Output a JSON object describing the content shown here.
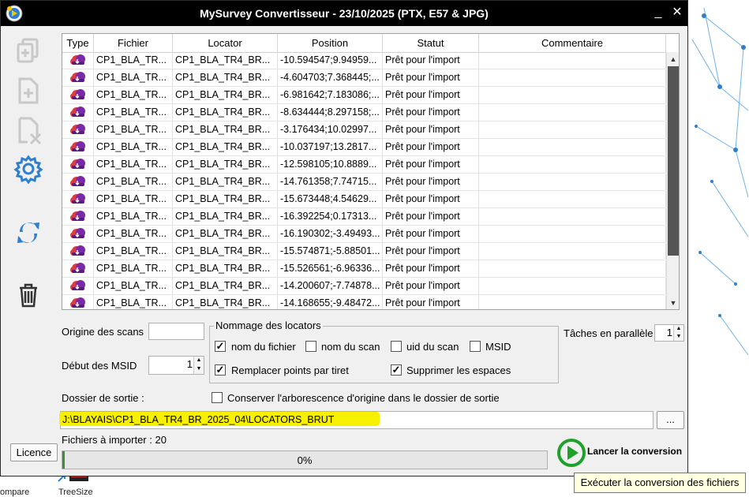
{
  "window": {
    "title": "MySurvey Convertisseur - 23/10/2025 (PTX, E57 & JPG)",
    "minimize_glyph": "_",
    "close_glyph": "✕"
  },
  "sidebar": {
    "icons": [
      "add-scan-icon",
      "add-file-icon",
      "remove-file-icon",
      "settings-gear-icon",
      "refresh-icon",
      "trash-icon"
    ]
  },
  "table": {
    "columns": [
      "Type",
      "Fichier",
      "Locator",
      "Position",
      "Statut",
      "Commentaire"
    ],
    "rows": [
      {
        "fichier": "CP1_BLA_TR...",
        "locator": "CP1_BLA_TR4_BR...",
        "position": "-10.594547;9.94959...",
        "statut": "Prêt pour l'import",
        "commentaire": ""
      },
      {
        "fichier": "CP1_BLA_TR...",
        "locator": "CP1_BLA_TR4_BR...",
        "position": "-4.604703;7.368445;...",
        "statut": "Prêt pour l'import",
        "commentaire": ""
      },
      {
        "fichier": "CP1_BLA_TR...",
        "locator": "CP1_BLA_TR4_BR...",
        "position": "-6.981642;7.183086;...",
        "statut": "Prêt pour l'import",
        "commentaire": ""
      },
      {
        "fichier": "CP1_BLA_TR...",
        "locator": "CP1_BLA_TR4_BR...",
        "position": "-8.634444;8.297158;...",
        "statut": "Prêt pour l'import",
        "commentaire": ""
      },
      {
        "fichier": "CP1_BLA_TR...",
        "locator": "CP1_BLA_TR4_BR...",
        "position": "-3.176434;10.02997...",
        "statut": "Prêt pour l'import",
        "commentaire": ""
      },
      {
        "fichier": "CP1_BLA_TR...",
        "locator": "CP1_BLA_TR4_BR...",
        "position": "-10.037197;13.2817...",
        "statut": "Prêt pour l'import",
        "commentaire": ""
      },
      {
        "fichier": "CP1_BLA_TR...",
        "locator": "CP1_BLA_TR4_BR...",
        "position": "-12.598105;10.8889...",
        "statut": "Prêt pour l'import",
        "commentaire": ""
      },
      {
        "fichier": "CP1_BLA_TR...",
        "locator": "CP1_BLA_TR4_BR...",
        "position": "-14.761358;7.74715...",
        "statut": "Prêt pour l'import",
        "commentaire": ""
      },
      {
        "fichier": "CP1_BLA_TR...",
        "locator": "CP1_BLA_TR4_BR...",
        "position": "-15.673448;4.54629...",
        "statut": "Prêt pour l'import",
        "commentaire": ""
      },
      {
        "fichier": "CP1_BLA_TR...",
        "locator": "CP1_BLA_TR4_BR...",
        "position": "-16.392254;0.17313...",
        "statut": "Prêt pour l'import",
        "commentaire": ""
      },
      {
        "fichier": "CP1_BLA_TR...",
        "locator": "CP1_BLA_TR4_BR...",
        "position": "-16.190302;-3.49493...",
        "statut": "Prêt pour l'import",
        "commentaire": ""
      },
      {
        "fichier": "CP1_BLA_TR...",
        "locator": "CP1_BLA_TR4_BR...",
        "position": "-15.574871;-5.88501...",
        "statut": "Prêt pour l'import",
        "commentaire": ""
      },
      {
        "fichier": "CP1_BLA_TR...",
        "locator": "CP1_BLA_TR4_BR...",
        "position": "-15.526561;-6.96336...",
        "statut": "Prêt pour l'import",
        "commentaire": ""
      },
      {
        "fichier": "CP1_BLA_TR...",
        "locator": "CP1_BLA_TR4_BR...",
        "position": "-14.200607;-7.74878...",
        "statut": "Prêt pour l'import",
        "commentaire": ""
      },
      {
        "fichier": "CP1_BLA_TR...",
        "locator": "CP1_BLA_TR4_BR...",
        "position": "-14.168655;-9.48472...",
        "statut": "Prêt pour l'import",
        "commentaire": ""
      }
    ]
  },
  "options": {
    "origine_label": "Origine des scans",
    "origine_value": "",
    "debut_msid_label": "Début des MSID",
    "debut_msid_value": "1",
    "taches_label": "Tâches en parallèle",
    "taches_value": "1",
    "nommage_legend": "Nommage des locators",
    "cb_nom_fichier": {
      "label": "nom du fichier",
      "checked": true
    },
    "cb_nom_scan": {
      "label": "nom du scan",
      "checked": false
    },
    "cb_uid_scan": {
      "label": "uid du scan",
      "checked": false
    },
    "cb_msid": {
      "label": "MSID",
      "checked": false
    },
    "cb_remplacer": {
      "label": "Remplacer points par tiret",
      "checked": true
    },
    "cb_supprimer": {
      "label": "Supprimer les espaces",
      "checked": true
    }
  },
  "output": {
    "dossier_label": "Dossier de sortie :",
    "cb_conserver": {
      "label": "Conserver l'arborescence d'origine dans le dossier de sortie",
      "checked": false
    },
    "path_value": "J:\\BLAYAIS\\CP1_BLA_TR4_BR_2025_04\\LOCATORS_BRUT",
    "browse_label": "..."
  },
  "status": {
    "fichiers_label": "Fichiers à importer : 20",
    "progress_text": "0%",
    "progress_fraction": 0.005,
    "licence_label": "Licence",
    "lancer_label": "Lancer la conversion",
    "tooltip": "Exécuter la conversion des fichiers"
  },
  "desktop": {
    "icon_labels": [
      "ompare",
      "TreeSize"
    ]
  },
  "colors": {
    "accent_blue": "#2f7fd0",
    "play_green": "#1fa12a",
    "highlight_yellow": "#f7f000",
    "tooltip_bg": "#ffffe1"
  }
}
